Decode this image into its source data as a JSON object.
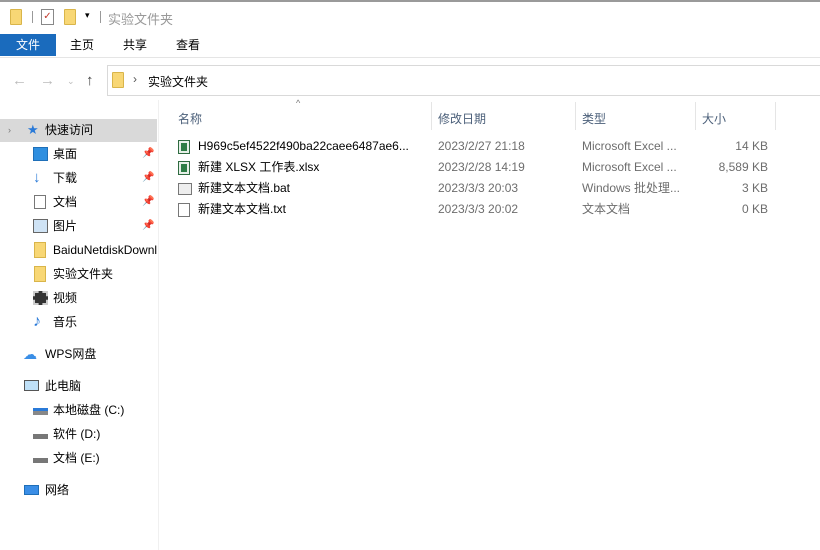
{
  "window": {
    "title": "实验文件夹"
  },
  "ribbon": {
    "tabs": [
      "文件",
      "主页",
      "共享",
      "查看"
    ]
  },
  "address": {
    "path": "实验文件夹"
  },
  "columns": {
    "name": "名称",
    "date": "修改日期",
    "type": "类型",
    "size": "大小"
  },
  "files": [
    {
      "name": "H969c5ef4522f490ba22caee6487ae6...",
      "date": "2023/2/27 21:18",
      "type": "Microsoft Excel ...",
      "size": "14 KB",
      "icon": "excel-file-icon"
    },
    {
      "name": "新建 XLSX 工作表.xlsx",
      "date": "2023/2/28 14:19",
      "type": "Microsoft Excel ...",
      "size": "8,589 KB",
      "icon": "excel-file-icon"
    },
    {
      "name": "新建文本文档.bat",
      "date": "2023/3/3 20:03",
      "type": "Windows 批处理...",
      "size": "3 KB",
      "icon": "batch-file-icon"
    },
    {
      "name": "新建文本文档.txt",
      "date": "2023/3/3 20:02",
      "type": "文本文档",
      "size": "0 KB",
      "icon": "text-file-icon"
    }
  ],
  "sidebar": {
    "items": [
      {
        "label": "快速访问"
      },
      {
        "label": "桌面"
      },
      {
        "label": "下载"
      },
      {
        "label": "文档"
      },
      {
        "label": "图片"
      },
      {
        "label": "BaiduNetdiskDownload"
      },
      {
        "label": "实验文件夹"
      },
      {
        "label": "视频"
      },
      {
        "label": "音乐"
      },
      {
        "label": "WPS网盘"
      },
      {
        "label": "此电脑"
      },
      {
        "label": "本地磁盘 (C:)"
      },
      {
        "label": "软件 (D:)"
      },
      {
        "label": "文档 (E:)"
      },
      {
        "label": "网络"
      }
    ]
  },
  "colors": {
    "accent": "#1a6bbd",
    "header_text": "#4c607a"
  }
}
